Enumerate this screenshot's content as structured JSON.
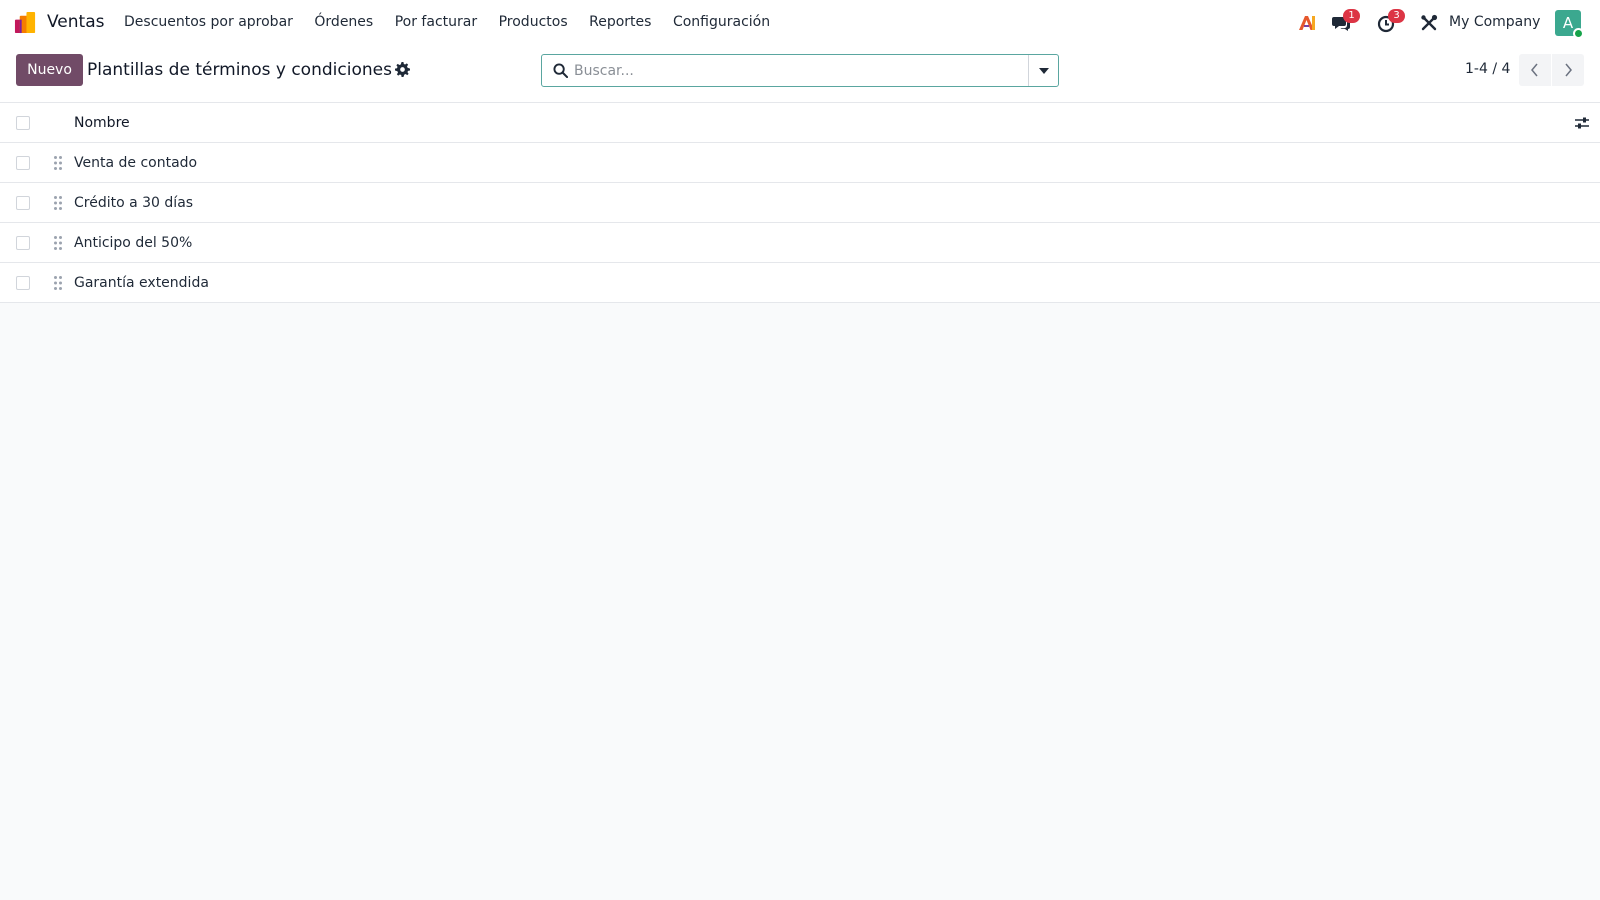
{
  "navbar": {
    "app_name": "Ventas",
    "menu": [
      "Descuentos por aprobar",
      "Órdenes",
      "Por facturar",
      "Productos",
      "Reportes",
      "Configuración"
    ],
    "messages_badge": "1",
    "activities_badge": "3",
    "company": "My Company",
    "avatar_letter": "A"
  },
  "control": {
    "new_label": "Nuevo",
    "title": "Plantillas de términos y condiciones",
    "search_placeholder": "Buscar...",
    "pager": "1-4 / 4"
  },
  "list": {
    "column_header": "Nombre",
    "rows": [
      "Venta de contado",
      "Crédito a 30 días",
      "Anticipo del 50%",
      "Garantía extendida"
    ]
  },
  "colors": {
    "brand": "#714b67",
    "search_border": "#5aa6a0",
    "avatar": "#3ba88f",
    "badge": "#dc3545"
  },
  "icons": {
    "app": "sales-app-icon",
    "ai": "ai-icon",
    "messages": "chat-icon",
    "activities": "clock-icon",
    "debug": "tools-icon",
    "title_gear": "gear-icon",
    "search": "search-icon",
    "toggle": "caret-down-icon",
    "drag": "drag-handle-icon",
    "optional_columns": "sliders-icon"
  }
}
